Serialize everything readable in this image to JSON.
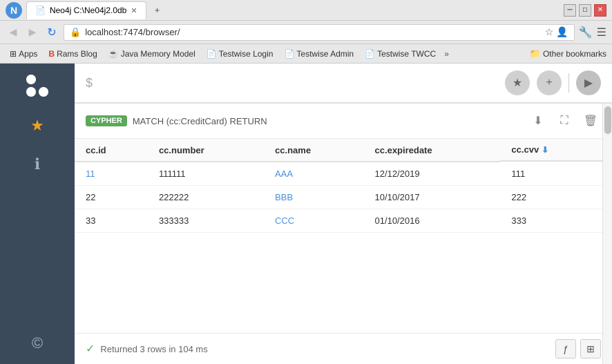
{
  "browser": {
    "tab_title": "Neo4j C:\\Ne04j2.0db",
    "url": "localhost:7474/browser/",
    "window_controls": [
      "minimize",
      "maximize",
      "close"
    ]
  },
  "bookmarks": {
    "items": [
      {
        "label": "Apps",
        "icon": "⊞"
      },
      {
        "label": "Rams Blog",
        "icon": "B"
      },
      {
        "label": "Java Memory Model",
        "icon": "☕"
      },
      {
        "label": "Testwise Login",
        "icon": "📄"
      },
      {
        "label": "Testwise Admin",
        "icon": "📄"
      },
      {
        "label": "Testwise TWCC",
        "icon": "📄"
      }
    ],
    "more_label": "»",
    "other_label": "Other bookmarks"
  },
  "sidebar": {
    "icons": [
      {
        "name": "logo",
        "type": "logo"
      },
      {
        "name": "favorites",
        "symbol": "★",
        "active": true
      },
      {
        "name": "info",
        "symbol": "ℹ",
        "active": false
      },
      {
        "name": "copyright",
        "symbol": "©",
        "active": false
      }
    ]
  },
  "query_bar": {
    "dollar_sign": "$",
    "buttons": [
      "★",
      "+",
      "▶"
    ]
  },
  "results": {
    "cypher_badge": "CYPHER",
    "query_text": "MATCH (cc:CreditCard) RETURN",
    "actions": [
      "⬇",
      "⛶",
      "🗑"
    ],
    "columns": [
      "cc.id",
      "cc.number",
      "cc.name",
      "cc.expiredate",
      "cc.cvv"
    ],
    "rows": [
      {
        "id": "11",
        "number": "111111",
        "name": "AAA",
        "expiredate": "12/12/2019",
        "cvv": "111",
        "id_link": true,
        "name_link": true
      },
      {
        "id": "22",
        "number": "222222",
        "name": "BBB",
        "expiredate": "10/10/2017",
        "cvv": "222",
        "id_link": false,
        "name_link": true
      },
      {
        "id": "33",
        "number": "333333",
        "name": "CCC",
        "expiredate": "01/10/2016",
        "cvv": "333",
        "id_link": false,
        "name_link": true
      }
    ],
    "status_text": "Returned 3 rows in 104 ms",
    "status_actions": [
      "ƒ",
      "⊞"
    ]
  }
}
